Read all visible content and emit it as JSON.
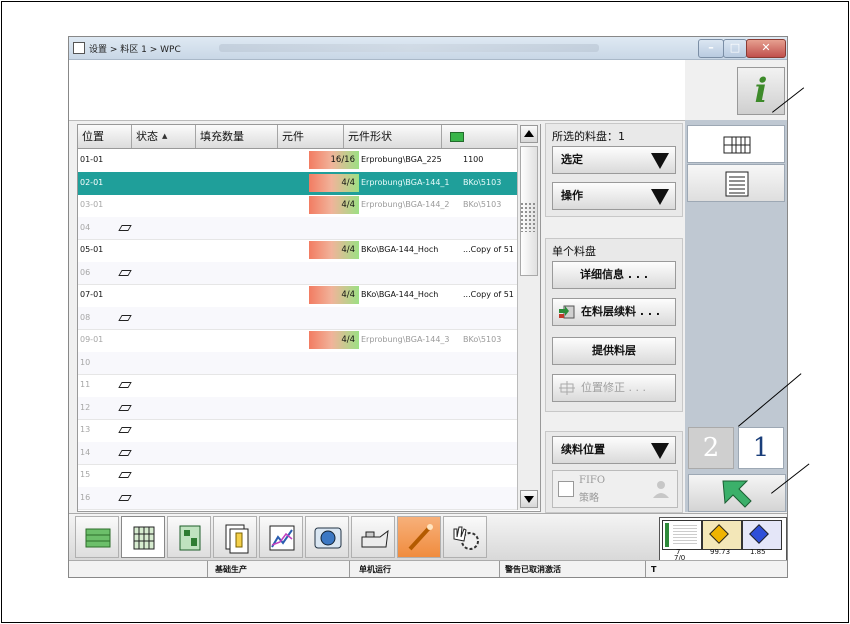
{
  "window": {
    "title": "设置 > 料区 1 > WPC",
    "controls": [
      "minimize",
      "maximize",
      "close"
    ]
  },
  "info_button": {
    "label": "i"
  },
  "grid": {
    "columns": [
      "位置",
      "状态",
      "填充数量",
      "元件",
      "元件形状"
    ],
    "rows": [
      {
        "pos": "01-01",
        "qty": "16/16",
        "component": "Erprobung\\BGA_225",
        "shape": "1100",
        "selected": false,
        "dim": false,
        "tray": false
      },
      {
        "pos": "02-01",
        "qty": "4/4",
        "component": "Erprobung\\BGA-144_1",
        "shape": "BKo\\5103",
        "selected": true,
        "dim": false,
        "tray": false
      },
      {
        "pos": "03-01",
        "qty": "4/4",
        "component": "Erprobung\\BGA-144_2",
        "shape": "BKo\\5103",
        "selected": false,
        "dim": true,
        "tray": false
      },
      {
        "pos": "04",
        "qty": "",
        "component": "",
        "shape": "",
        "selected": false,
        "dim": true,
        "tray": true
      },
      {
        "pos": "05-01",
        "qty": "4/4",
        "component": "BKo\\BGA-144_Hoch",
        "shape": "...Copy of 51",
        "selected": false,
        "dim": false,
        "tray": false
      },
      {
        "pos": "06",
        "qty": "",
        "component": "",
        "shape": "",
        "selected": false,
        "dim": true,
        "tray": true
      },
      {
        "pos": "07-01",
        "qty": "4/4",
        "component": "BKo\\BGA-144_Hoch",
        "shape": "...Copy of 51",
        "selected": false,
        "dim": false,
        "tray": false
      },
      {
        "pos": "08",
        "qty": "",
        "component": "",
        "shape": "",
        "selected": false,
        "dim": true,
        "tray": true
      },
      {
        "pos": "09-01",
        "qty": "4/4",
        "component": "Erprobung\\BGA-144_3",
        "shape": "BKo\\5103",
        "selected": false,
        "dim": true,
        "tray": false
      },
      {
        "pos": "10",
        "qty": "",
        "component": "",
        "shape": "",
        "selected": false,
        "dim": true,
        "tray": false
      },
      {
        "pos": "11",
        "qty": "",
        "component": "",
        "shape": "",
        "selected": false,
        "dim": true,
        "tray": true
      },
      {
        "pos": "12",
        "qty": "",
        "component": "",
        "shape": "",
        "selected": false,
        "dim": true,
        "tray": true
      },
      {
        "pos": "13",
        "qty": "",
        "component": "",
        "shape": "",
        "selected": false,
        "dim": true,
        "tray": true
      },
      {
        "pos": "14",
        "qty": "",
        "component": "",
        "shape": "",
        "selected": false,
        "dim": true,
        "tray": true
      },
      {
        "pos": "15",
        "qty": "",
        "component": "",
        "shape": "",
        "selected": false,
        "dim": true,
        "tray": true
      },
      {
        "pos": "16",
        "qty": "",
        "component": "",
        "shape": "",
        "selected": false,
        "dim": true,
        "tray": true
      }
    ]
  },
  "right_panel": {
    "selected_trays_label": "所选的料盘：1",
    "select_button": "选定",
    "operate_button": "操作",
    "single_tray_title": "单个料盘",
    "details_button": "详细信息 . . .",
    "refill_button": "在料层续料 . . .",
    "provide_button": "提供料层",
    "correct_button": "位置修正 . . .",
    "refill_position_button": "续料位置",
    "fifo_label_line1": "FIFO",
    "fifo_label_line2": "策略"
  },
  "pager": {
    "page_2": "2",
    "page_1": "1"
  },
  "mini_status": {
    "left_count": "7",
    "left_sub": "7/0",
    "value_mid": "99.73",
    "value_right": "1.85"
  },
  "status_bar": {
    "mode": "基础生产",
    "run": "单机运行",
    "alarm": "警告已取消激活",
    "extra": "T"
  },
  "colors": {
    "selected_row": "#1f9f9a",
    "accent_green": "#3d8a2a",
    "qty_red": "#f27c62",
    "qty_green": "#9de084"
  }
}
